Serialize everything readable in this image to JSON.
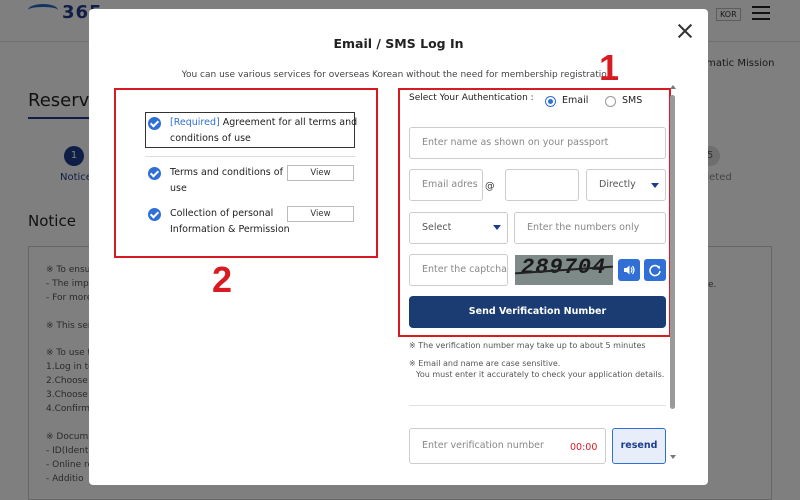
{
  "background": {
    "logo": "365",
    "lang": "KOR",
    "mission": "omatic Mission",
    "title": "Reserva",
    "step1_num": "1",
    "step1_label": "Notice",
    "step5_num": "5",
    "step5_label": "pleted",
    "notice": "Notice",
    "lines": [
      "※ To ensu",
      "- The impl",
      "- For more",
      "※ This ser",
      "※ To use t",
      "1.Log in to",
      "2.Choose t",
      "3.Choose t",
      "4.Confirm",
      "※ Docum",
      "- ID(Identi",
      "- Online re",
      "- Additio"
    ],
    "period": "e."
  },
  "modal": {
    "title": "Email / SMS Log In",
    "subtitle": "You can use various services for overseas Korean without the need for membership registration.",
    "agreements": {
      "all_required": "[Required]",
      "all_label_line1": "Agreement for all terms and",
      "all_label_line2": "conditions of use",
      "terms_line1": "Terms and conditions of",
      "terms_line2": "use",
      "collection_line1": "Collection of personal",
      "collection_line2": "Information & Permission",
      "view_label": "View"
    },
    "auth": {
      "label": "Select Your Authentication :",
      "option_email": "Email",
      "option_sms": "SMS",
      "selected": "Email",
      "name_placeholder": "Enter name as shown on your passport",
      "email_placeholder": "Email adres",
      "at": "@",
      "domain_select": "Directly",
      "country_select": "Select",
      "numbers_placeholder": "Enter the numbers only",
      "captcha_placeholder": "Enter the captcha",
      "captcha_text": "289704",
      "send_button": "Send Verification Number",
      "note1": "※ The verification number may take up to about 5 minutes",
      "note2_line1": "※ Email and name are case sensitive.",
      "note2_line2": "You must enter it accurately to check your application details.",
      "verification_placeholder": "Enter verification number",
      "timer": "00:00",
      "resend_button": "resend"
    },
    "annotations": {
      "box1_number": "1",
      "box2_number": "2",
      "color": "#d81b23"
    }
  },
  "colors": {
    "accent": "#2f6fd6",
    "primary_button": "#1b3c73",
    "overlay": "rgba(0,0,0,0.5)"
  }
}
